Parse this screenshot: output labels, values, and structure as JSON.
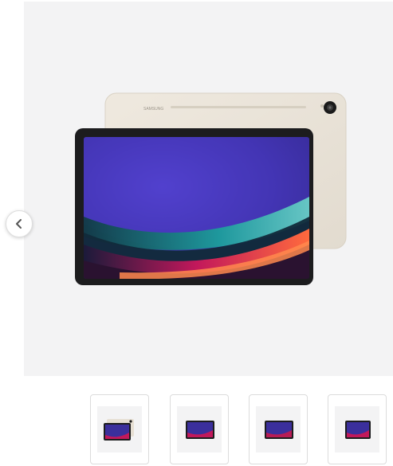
{
  "gallery": {
    "brand_mark": "SAMSUNG",
    "image_subject": "tablet",
    "prev_icon": "chevron-left-icon",
    "colors": {
      "stage_bg": "#f3f3f4",
      "tablet_back": "#e9e3d8",
      "bezel": "#1c1c1e",
      "screen_base": "#3b2f9c"
    },
    "thumbnails": [
      {
        "view": "back-and-front"
      },
      {
        "view": "front"
      },
      {
        "view": "front-angle"
      },
      {
        "view": "front-side"
      }
    ]
  }
}
